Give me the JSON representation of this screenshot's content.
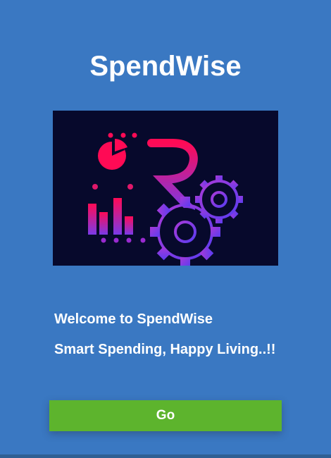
{
  "app": {
    "title": "SpendWise"
  },
  "logo": {
    "icon": "rupee-gears-chart-icon",
    "background_color": "#07092c",
    "gradient_start": "#ff0a55",
    "gradient_end": "#6a3cf0"
  },
  "content": {
    "welcome_text": "Welcome to SpendWise",
    "tagline": "Smart Spending, Happy Living..!!"
  },
  "actions": {
    "go_label": "Go",
    "go_color": "#5db42d"
  },
  "theme": {
    "background": "#3a78c2"
  }
}
